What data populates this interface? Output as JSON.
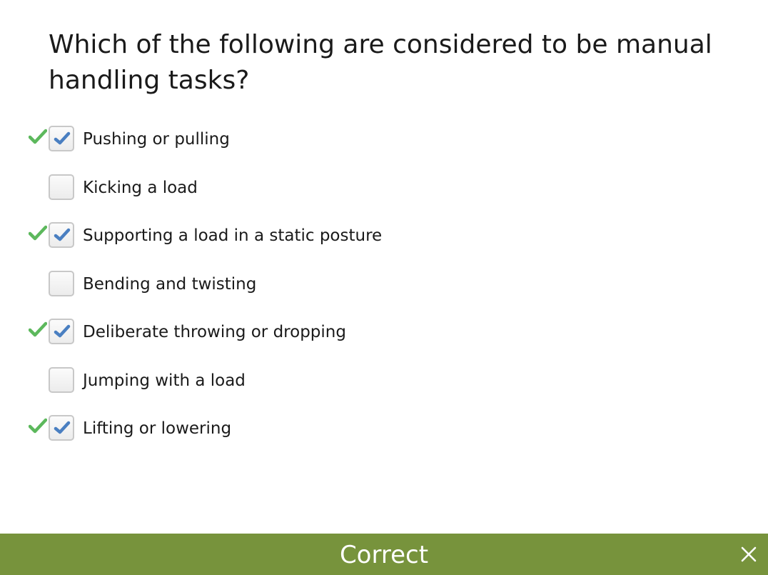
{
  "question": {
    "text": "Which of the following are considered to be manual handling tasks?"
  },
  "options": [
    {
      "label": "Pushing or pulling",
      "checked": true,
      "correct": true
    },
    {
      "label": "Kicking a load",
      "checked": false,
      "correct": false
    },
    {
      "label": "Supporting a load in a static posture",
      "checked": true,
      "correct": true
    },
    {
      "label": "Bending and twisting",
      "checked": false,
      "correct": false
    },
    {
      "label": "Deliberate throwing or dropping",
      "checked": true,
      "correct": true
    },
    {
      "label": "Jumping with a load",
      "checked": false,
      "correct": false
    },
    {
      "label": "Lifting or lowering",
      "checked": true,
      "correct": true
    }
  ],
  "feedback": {
    "text": "Correct",
    "bar_color": "#77933c"
  },
  "colors": {
    "checkmark": "#4a7fc1",
    "correct_mark": "#5cb85c"
  },
  "icons": {
    "correct_mark": "green-check-icon",
    "checkbox_check": "blue-check-icon",
    "close": "close-icon"
  }
}
